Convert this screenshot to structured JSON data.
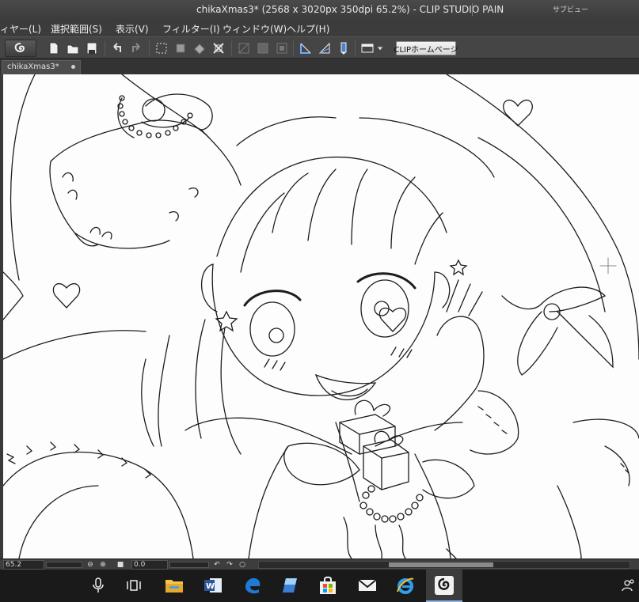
{
  "window": {
    "title": "chikaXmas3* (2568 x 3020px 350dpi 65.2%)  - CLIP STUDIO PAIN",
    "sub_view_label": "サブビュー"
  },
  "menubar": {
    "items": [
      {
        "label": "ィヤー(L)"
      },
      {
        "label": "選択範囲(S)"
      },
      {
        "label": "表示(V)"
      },
      {
        "label": "フィルター(I)"
      },
      {
        "label": "ウィンドウ(W)"
      },
      {
        "label": "ヘルプ(H)"
      }
    ]
  },
  "toolbar": {
    "clip_home_label": "CLIPホームページ",
    "icons": [
      "clip-studio-logo-icon",
      "new-file-icon",
      "open-folder-icon",
      "save-icon",
      "undo-icon",
      "redo-icon",
      "deselect-icon",
      "transform-icon",
      "fill-icon",
      "scale-icon",
      "layer-lock-icon",
      "layer-merge-icon",
      "layer-hide-icon",
      "ruler-icon",
      "perspective-icon",
      "pen-icon",
      "layout-icon"
    ]
  },
  "document_tab": {
    "label": "chikaXmas3*"
  },
  "status": {
    "zoom": "65.2",
    "angle": "0.0"
  },
  "taskbar": {
    "icons": [
      "microphone-icon",
      "task-view-icon",
      "file-explorer-icon",
      "word-icon",
      "edge-icon",
      "cortana-icon",
      "store-icon",
      "mail-icon",
      "internet-explorer-icon",
      "clip-studio-taskbar-icon",
      "people-icon"
    ]
  }
}
